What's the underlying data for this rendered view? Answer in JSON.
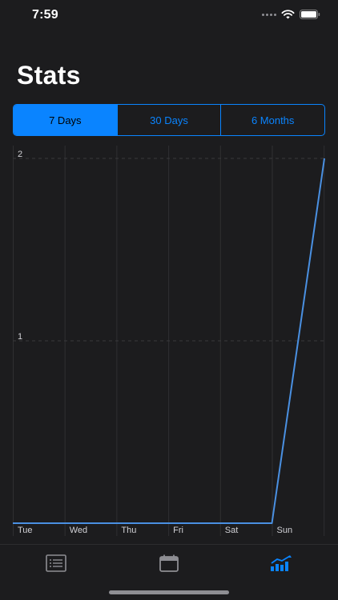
{
  "status_bar": {
    "time": "7:59"
  },
  "page": {
    "title": "Stats"
  },
  "range_selector": {
    "options": [
      {
        "label": "7 Days",
        "selected": true
      },
      {
        "label": "30 Days",
        "selected": false
      },
      {
        "label": "6 Months",
        "selected": false
      }
    ]
  },
  "chart_data": {
    "type": "line",
    "categories": [
      "Tue",
      "Wed",
      "Thu",
      "Fri",
      "Sat",
      "Sun"
    ],
    "values": [
      0,
      0,
      0,
      0,
      0,
      0,
      2
    ],
    "y_ticks": [
      "1",
      "2"
    ],
    "ylim": [
      0,
      2
    ],
    "grid": true,
    "line_color": "#4a90e2"
  },
  "tab_bar": {
    "tabs": [
      {
        "icon": "list-icon",
        "active": false
      },
      {
        "icon": "calendar-icon",
        "active": false
      },
      {
        "icon": "stats-chart-icon",
        "active": true
      }
    ],
    "active_color": "#0a84ff",
    "inactive_color": "#8e8e93"
  }
}
